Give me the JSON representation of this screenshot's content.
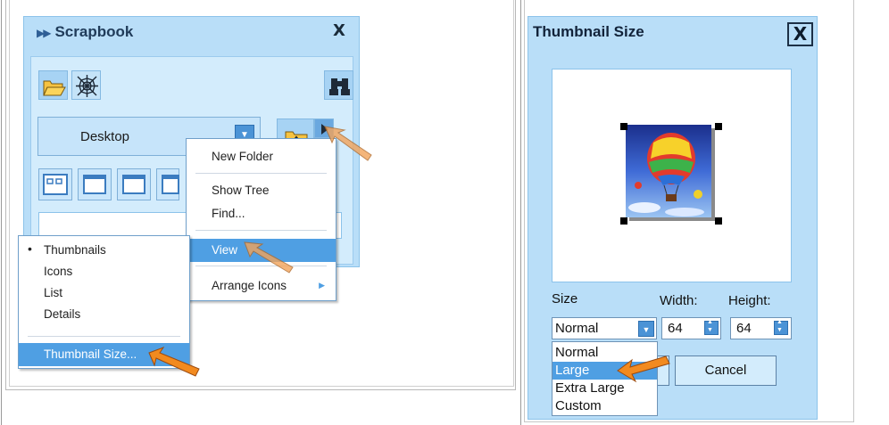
{
  "scrapbook": {
    "title": "Scrapbook",
    "close_label": "X",
    "folder_dropdown_value": "Desktop",
    "context_menu": {
      "items": [
        {
          "label": "New Folder"
        },
        {
          "label": "Show Tree"
        },
        {
          "label": "Find..."
        },
        {
          "label": "View"
        },
        {
          "label": "Arrange Icons"
        }
      ]
    },
    "view_submenu": {
      "bullet": "•",
      "items": [
        {
          "label": "Thumbnails"
        },
        {
          "label": "Icons"
        },
        {
          "label": "List"
        },
        {
          "label": "Details"
        },
        {
          "label": "Thumbnail Size..."
        }
      ]
    }
  },
  "thumbnail_dialog": {
    "title": "Thumbnail Size",
    "close_label": "X",
    "size_label": "Size",
    "width_label": "Width:",
    "height_label": "Height:",
    "size_value": "Normal",
    "width_value": "64",
    "height_value": "64",
    "size_options": [
      {
        "label": "Normal"
      },
      {
        "label": "Large"
      },
      {
        "label": "Extra Large"
      },
      {
        "label": "Custom"
      }
    ],
    "cancel_label": "Cancel"
  },
  "colors": {
    "panel_bg": "#b9def8",
    "highlight": "#4f9fe3",
    "pointer": "#f28a1f"
  }
}
